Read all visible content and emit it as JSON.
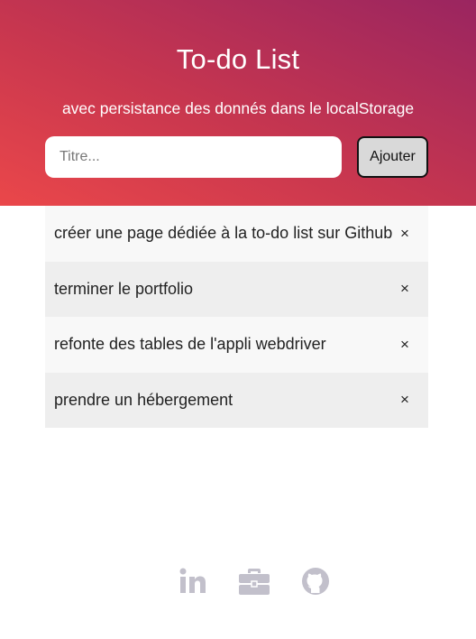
{
  "header": {
    "title": "To-do List",
    "subtitle": "avec persistance des donnés dans le localStorage"
  },
  "form": {
    "placeholder": "Titre...",
    "value": "",
    "add_label": "Ajouter"
  },
  "todos": [
    {
      "text": "créer une page dédiée à la to-do list sur Github",
      "remove": "×"
    },
    {
      "text": "terminer le portfolio",
      "remove": "×"
    },
    {
      "text": "refonte des tables de l'appli webdriver",
      "remove": "×"
    },
    {
      "text": "prendre un hébergement",
      "remove": "×"
    }
  ],
  "footer": {
    "icons": [
      "linkedin-icon",
      "briefcase-icon",
      "github-icon"
    ],
    "icon_color": "#c2c0cb"
  },
  "colors": {
    "gradient_start": "#ea474a",
    "gradient_end": "#9a2560"
  }
}
